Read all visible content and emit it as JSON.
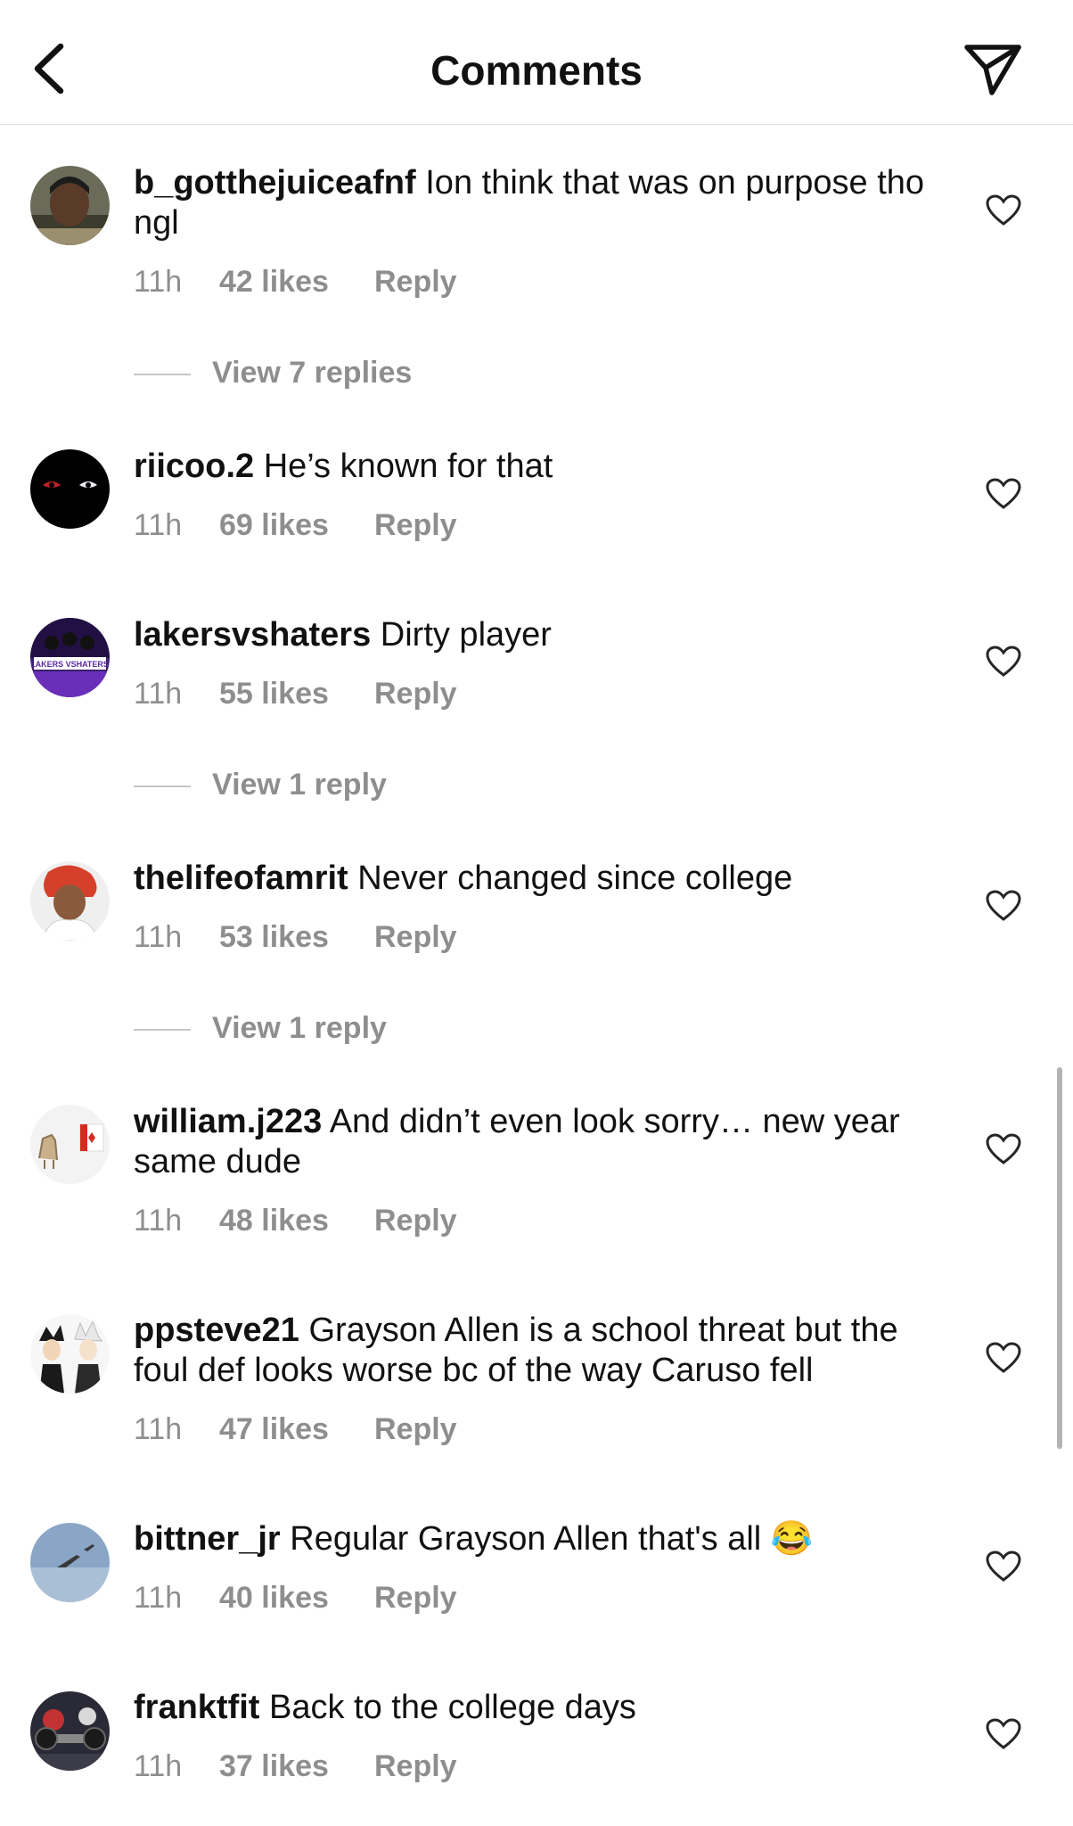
{
  "header": {
    "title": "Comments",
    "back_icon": "chevron-left-icon",
    "share_icon": "paper-plane-icon"
  },
  "comments": [
    {
      "username": "b_gotthejuiceafnf",
      "text": "Ion think that was on purpose tho ngl",
      "time": "11h",
      "likes": "42 likes",
      "reply": "Reply",
      "view_replies": "View 7 replies"
    },
    {
      "username": "riicoo.2",
      "text": "He’s known for that",
      "time": "11h",
      "likes": "69 likes",
      "reply": "Reply"
    },
    {
      "username": "lakersvshaters",
      "text": "Dirty player",
      "time": "11h",
      "likes": "55 likes",
      "reply": "Reply",
      "view_replies": "View 1 reply",
      "avatar_text": "LAKERS VSHATERS"
    },
    {
      "username": "thelifeofamrit",
      "text": "Never changed since college",
      "time": "11h",
      "likes": "53 likes",
      "reply": "Reply",
      "view_replies": "View 1 reply"
    },
    {
      "username": "william.j223",
      "text": "And didn’t even look sorry… new year same dude",
      "time": "11h",
      "likes": "48 likes",
      "reply": "Reply"
    },
    {
      "username": "ppsteve21",
      "text": "Grayson Allen is a school threat but the foul def looks worse bc of the way Caruso fell",
      "time": "11h",
      "likes": "47 likes",
      "reply": "Reply"
    },
    {
      "username": "bittner_jr",
      "text": "Regular Grayson Allen that's all",
      "emoji": "😂",
      "time": "11h",
      "likes": "40 likes",
      "reply": "Reply"
    },
    {
      "username": "franktfit",
      "text": "Back to the college days",
      "time": "11h",
      "likes": "37 likes",
      "reply": "Reply"
    }
  ]
}
